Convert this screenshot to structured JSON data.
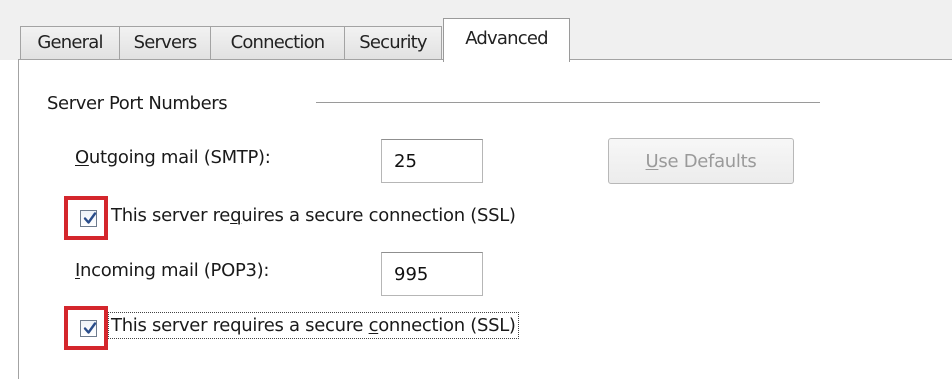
{
  "tabs": [
    {
      "label": "General",
      "active": false
    },
    {
      "label": "Servers",
      "active": false
    },
    {
      "label": "Connection",
      "active": false
    },
    {
      "label": "Security",
      "active": false
    },
    {
      "label": "Advanced",
      "active": true
    }
  ],
  "group": {
    "title": "Server Port Numbers"
  },
  "outgoing": {
    "label_access": "O",
    "label_rest": "utgoing mail (SMTP):",
    "port_value": "25",
    "ssl_required": true,
    "ssl_label_pre": "This server re",
    "ssl_label_access": "q",
    "ssl_label_post": "uires a secure connection (SSL)"
  },
  "defaults_button": {
    "label_access": "U",
    "label_rest": "se Defaults",
    "enabled": false
  },
  "incoming": {
    "label_access": "I",
    "label_rest": "ncoming mail (POP3):",
    "port_value": "995",
    "ssl_required": true,
    "ssl_label_pre": "This server requires a secure ",
    "ssl_label_access": "c",
    "ssl_label_post": "onnection (SSL)"
  },
  "colors": {
    "highlight_box": "#d4262c",
    "check_mark": "#2a4d8a",
    "disabled_text": "#9a9a9a"
  }
}
